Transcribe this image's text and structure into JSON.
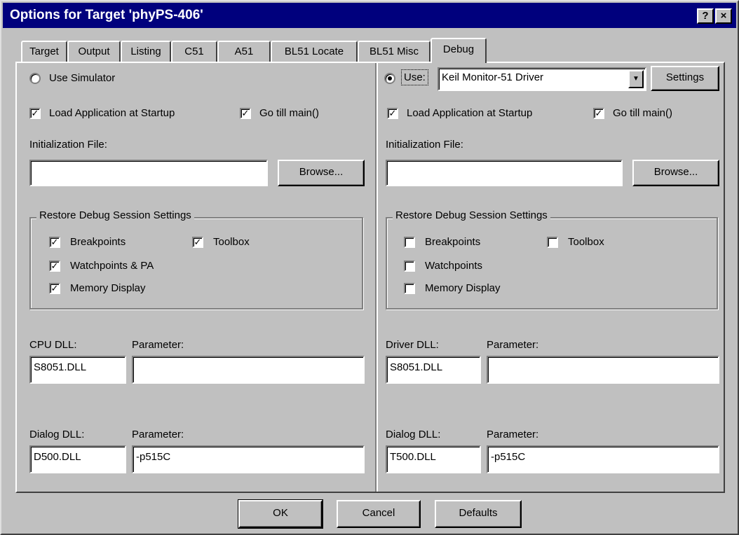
{
  "window": {
    "title": "Options for Target 'phyPS-406'",
    "help_label": "?",
    "close_label": "×"
  },
  "tabs": [
    {
      "label": "Target"
    },
    {
      "label": "Output"
    },
    {
      "label": "Listing"
    },
    {
      "label": "C51"
    },
    {
      "label": "A51"
    },
    {
      "label": "BL51 Locate"
    },
    {
      "label": "BL51 Misc"
    },
    {
      "label": "Debug",
      "active": true
    }
  ],
  "left": {
    "mode_label": "Use Simulator",
    "mode_selected": false,
    "load_app_label": "Load Application at Startup",
    "load_app_checked": true,
    "go_main_label": "Go till main()",
    "go_main_checked": true,
    "init_file_label": "Initialization File:",
    "init_file_value": "",
    "browse_label": "Browse...",
    "restore_group_title": "Restore Debug Session Settings",
    "breakpoints_label": "Breakpoints",
    "breakpoints_checked": true,
    "toolbox_label": "Toolbox",
    "toolbox_checked": true,
    "watchpoints_label": "Watchpoints & PA",
    "watchpoints_checked": true,
    "memory_label": "Memory Display",
    "memory_checked": true,
    "cpu_dll_label": "CPU DLL:",
    "cpu_dll_value": "S8051.DLL",
    "cpu_param_label": "Parameter:",
    "cpu_param_value": "",
    "dialog_dll_label": "Dialog DLL:",
    "dialog_dll_value": "D500.DLL",
    "dialog_param_label": "Parameter:",
    "dialog_param_value": "-p515C"
  },
  "right": {
    "mode_label": "Use:",
    "mode_selected": true,
    "driver_selected": "Keil Monitor-51 Driver",
    "settings_label": "Settings",
    "load_app_label": "Load Application at Startup",
    "load_app_checked": true,
    "go_main_label": "Go till main()",
    "go_main_checked": true,
    "init_file_label": "Initialization File:",
    "init_file_value": "",
    "browse_label": "Browse...",
    "restore_group_title": "Restore Debug Session Settings",
    "breakpoints_label": "Breakpoints",
    "breakpoints_checked": false,
    "toolbox_label": "Toolbox",
    "toolbox_checked": false,
    "watchpoints_label": "Watchpoints",
    "watchpoints_checked": false,
    "memory_label": "Memory Display",
    "memory_checked": false,
    "driver_dll_label": "Driver DLL:",
    "driver_dll_value": "S8051.DLL",
    "driver_param_label": "Parameter:",
    "driver_param_value": "",
    "dialog_dll_label": "Dialog DLL:",
    "dialog_dll_value": "T500.DLL",
    "dialog_param_label": "Parameter:",
    "dialog_param_value": "-p515C"
  },
  "footer": {
    "ok_label": "OK",
    "cancel_label": "Cancel",
    "defaults_label": "Defaults"
  },
  "checkmark_glyph": "✓"
}
